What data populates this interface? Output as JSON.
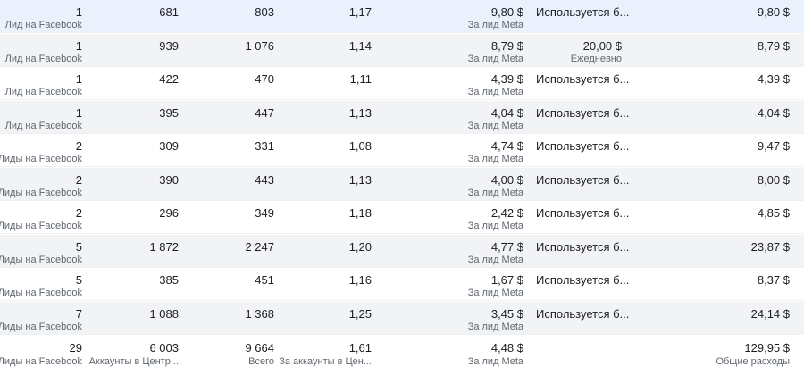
{
  "rows": [
    {
      "results": "1",
      "results_label": "Лид на Facebook",
      "reach": "681",
      "impressions": "803",
      "frequency": "1,17",
      "cost_per_result": "9,80 $",
      "cost_label": "За лид Meta",
      "budget": "Используется б...",
      "budget_label": "",
      "spent": "9,80 $"
    },
    {
      "results": "1",
      "results_label": "Лид на Facebook",
      "reach": "939",
      "impressions": "1 076",
      "frequency": "1,14",
      "cost_per_result": "8,79 $",
      "cost_label": "За лид Meta",
      "budget": "20,00 $",
      "budget_label": "Ежедневно",
      "spent": "8,79 $"
    },
    {
      "results": "1",
      "results_label": "Лид на Facebook",
      "reach": "422",
      "impressions": "470",
      "frequency": "1,11",
      "cost_per_result": "4,39 $",
      "cost_label": "За лид Meta",
      "budget": "Используется б...",
      "budget_label": "",
      "spent": "4,39 $"
    },
    {
      "results": "1",
      "results_label": "Лид на Facebook",
      "reach": "395",
      "impressions": "447",
      "frequency": "1,13",
      "cost_per_result": "4,04 $",
      "cost_label": "За лид Meta",
      "budget": "Используется б...",
      "budget_label": "",
      "spent": "4,04 $"
    },
    {
      "results": "2",
      "results_label": "Лиды на Facebook",
      "reach": "309",
      "impressions": "331",
      "frequency": "1,08",
      "cost_per_result": "4,74 $",
      "cost_label": "За лид Meta",
      "budget": "Используется б...",
      "budget_label": "",
      "spent": "9,47 $"
    },
    {
      "results": "2",
      "results_label": "Лиды на Facebook",
      "reach": "390",
      "impressions": "443",
      "frequency": "1,13",
      "cost_per_result": "4,00 $",
      "cost_label": "За лид Meta",
      "budget": "Используется б...",
      "budget_label": "",
      "spent": "8,00 $"
    },
    {
      "results": "2",
      "results_label": "Лиды на Facebook",
      "reach": "296",
      "impressions": "349",
      "frequency": "1,18",
      "cost_per_result": "2,42 $",
      "cost_label": "За лид Meta",
      "budget": "Используется б...",
      "budget_label": "",
      "spent": "4,85 $"
    },
    {
      "results": "5",
      "results_label": "Лиды на Facebook",
      "reach": "1 872",
      "impressions": "2 247",
      "frequency": "1,20",
      "cost_per_result": "4,77 $",
      "cost_label": "За лид Meta",
      "budget": "Используется б...",
      "budget_label": "",
      "spent": "23,87 $"
    },
    {
      "results": "5",
      "results_label": "Лиды на Facebook",
      "reach": "385",
      "impressions": "451",
      "frequency": "1,16",
      "cost_per_result": "1,67 $",
      "cost_label": "За лид Meta",
      "budget": "Используется б...",
      "budget_label": "",
      "spent": "8,37 $"
    },
    {
      "results": "7",
      "results_label": "Лиды на Facebook",
      "reach": "1 088",
      "impressions": "1 368",
      "frequency": "1,25",
      "cost_per_result": "3,45 $",
      "cost_label": "За лид Meta",
      "budget": "Используется б...",
      "budget_label": "",
      "spent": "24,14 $"
    }
  ],
  "totals": {
    "results": "29",
    "results_label": "Лиды на Facebook",
    "reach": "6 003",
    "reach_label": "Аккаунты в Центр...",
    "impressions": "9 664",
    "impressions_label": "Всего",
    "frequency": "1,61",
    "frequency_label": "За аккаунты в Цен...",
    "cost_per_result": "4,48 $",
    "cost_label": "За лид Meta",
    "spent": "129,95 $",
    "spent_label": "Общие расходы"
  },
  "colors": {
    "row_alt": "#f2f3f5",
    "row_highlight": "#eaf1fd",
    "text": "#1c1e21",
    "subtext": "#606770"
  }
}
